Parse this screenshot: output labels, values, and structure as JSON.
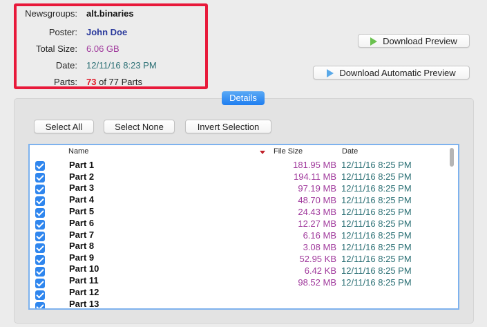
{
  "header": {
    "newsgroups_label": "Newsgroups:",
    "newsgroups_value": "alt.binaries",
    "poster_label": "Poster:",
    "poster_value": "John Doe",
    "total_size_label": "Total Size:",
    "total_size_value": "6.06 GB",
    "date_label": "Date:",
    "date_value": "12/11/16 8:23 PM",
    "parts_label": "Parts:",
    "parts_count": "73",
    "parts_suffix": "of 77 Parts"
  },
  "actions": {
    "download_preview": "Download Preview",
    "download_automatic_preview": "Download Automatic Preview"
  },
  "details_tab": "Details",
  "selection": {
    "select_all": "Select All",
    "select_none": "Select None",
    "invert_selection": "Invert Selection"
  },
  "table": {
    "columns": {
      "name": "Name",
      "file_size": "File Size",
      "date": "Date"
    },
    "rows": [
      {
        "name": "Part 1",
        "size": "181.95 MB",
        "date": "12/11/16 8:25 PM",
        "checked": true
      },
      {
        "name": "Part 2",
        "size": "194.11 MB",
        "date": "12/11/16 8:25 PM",
        "checked": true
      },
      {
        "name": "Part 3",
        "size": "97.19 MB",
        "date": "12/11/16 8:25 PM",
        "checked": true
      },
      {
        "name": "Part 4",
        "size": "48.70 MB",
        "date": "12/11/16 8:25 PM",
        "checked": true
      },
      {
        "name": "Part 5",
        "size": "24.43 MB",
        "date": "12/11/16 8:25 PM",
        "checked": true
      },
      {
        "name": "Part 6",
        "size": "12.27 MB",
        "date": "12/11/16 8:25 PM",
        "checked": true
      },
      {
        "name": "Part 7",
        "size": "6.16 MB",
        "date": "12/11/16 8:25 PM",
        "checked": true
      },
      {
        "name": "Part 8",
        "size": "3.08 MB",
        "date": "12/11/16 8:25 PM",
        "checked": true
      },
      {
        "name": "Part 9",
        "size": "52.95 KB",
        "date": "12/11/16 8:25 PM",
        "checked": true
      },
      {
        "name": "Part 10",
        "size": "6.42 KB",
        "date": "12/11/16 8:25 PM",
        "checked": true
      },
      {
        "name": "Part 11",
        "size": "98.52 MB",
        "date": "12/11/16 8:25 PM",
        "checked": true
      },
      {
        "name": "Part 12",
        "size": "",
        "date": "",
        "checked": true
      },
      {
        "name": "Part 13",
        "size": "",
        "date": "",
        "checked": true
      }
    ]
  },
  "colors": {
    "highlight_border": "#e8193a",
    "accent_blue": "#2f86ee",
    "size_purple": "#a0399c",
    "date_teal": "#2a6f74",
    "parts_red": "#e01b2a"
  }
}
